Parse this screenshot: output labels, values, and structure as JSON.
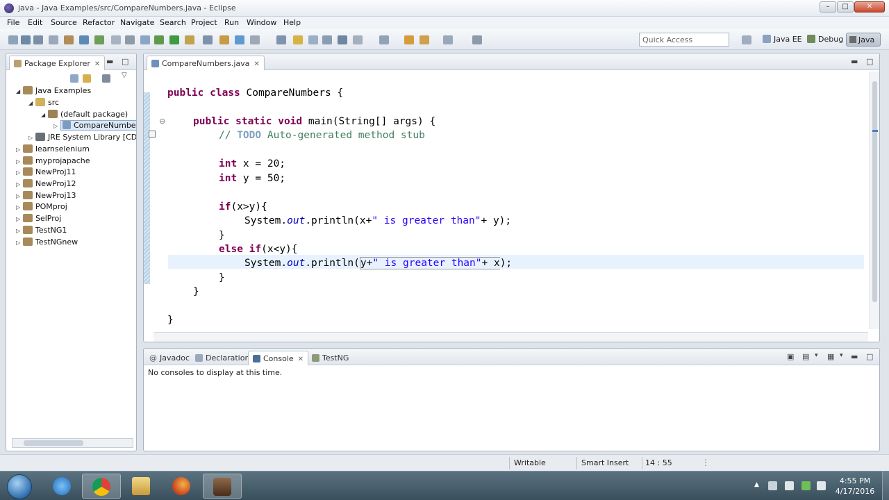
{
  "window": {
    "title": "java - Java Examples/src/CompareNumbers.java - Eclipse"
  },
  "menu": [
    "File",
    "Edit",
    "Source",
    "Refactor",
    "Navigate",
    "Search",
    "Project",
    "Run",
    "Window",
    "Help"
  ],
  "toolbar": {
    "quick_access_placeholder": "Quick Access",
    "perspectives": [
      "Java EE",
      "Debug",
      "Java"
    ]
  },
  "package_explorer": {
    "tab_label": "Package Explorer",
    "tree": [
      {
        "label": "Java Examples",
        "arrow": "◢"
      },
      {
        "label": "src",
        "arrow": "◢"
      },
      {
        "label": "(default package)",
        "arrow": "◢"
      },
      {
        "label": "CompareNumbe",
        "arrow": "▷"
      },
      {
        "label": "JRE System Library [CDC",
        "arrow": "▷"
      },
      {
        "label": "learnselenium",
        "arrow": "▷"
      },
      {
        "label": "myprojapache",
        "arrow": "▷"
      },
      {
        "label": "NewProj11",
        "arrow": "▷"
      },
      {
        "label": "NewProj12",
        "arrow": "▷"
      },
      {
        "label": "NewProj13",
        "arrow": "▷"
      },
      {
        "label": "POMproj",
        "arrow": "▷"
      },
      {
        "label": "SelProj",
        "arrow": "▷"
      },
      {
        "label": "TestNG1",
        "arrow": "▷"
      },
      {
        "label": "TestNGnew",
        "arrow": "▷"
      }
    ]
  },
  "editor": {
    "tab_label": "CompareNumbers.java",
    "code": {
      "l1_kw": "public class",
      "l1_rest": " CompareNumbers {",
      "l2_kw": "public static void",
      "l2_rest": " main(String[] args) {",
      "l3_cmt": "// ",
      "l3_todo": "TODO",
      "l3_rest": " Auto-generated method stub",
      "l4_kw": "int",
      "l4_rest": " x = 20;",
      "l5_kw": "int",
      "l5_rest": " y = 50;",
      "l6_kw": "if",
      "l6_rest": "(x>y){",
      "l7_a": "System.",
      "l7_out": "out",
      "l7_b": ".println(x+",
      "l7_str": "\" is greater than\"",
      "l7_c": "+ y);",
      "l8": "}",
      "l9_kw1": "else",
      "l9_kw2": "if",
      "l9_rest": "(x<y){",
      "l10_a": "System.",
      "l10_out": "out",
      "l10_b": ".println(",
      "l10_c": "y+",
      "l10_str": "\" is greater than\"",
      "l10_d": "+ x",
      "l10_e": ");",
      "l11": "}",
      "l12": "}",
      "l13": "}"
    }
  },
  "bottom_panel": {
    "tabs": [
      "Javadoc",
      "Declaration",
      "Console",
      "TestNG"
    ],
    "console_message": "No consoles to display at this time."
  },
  "status": {
    "writable": "Writable",
    "insert_mode": "Smart Insert",
    "position": "14 : 55"
  },
  "taskbar": {
    "time": "4:55 PM",
    "date": "4/17/2016"
  }
}
